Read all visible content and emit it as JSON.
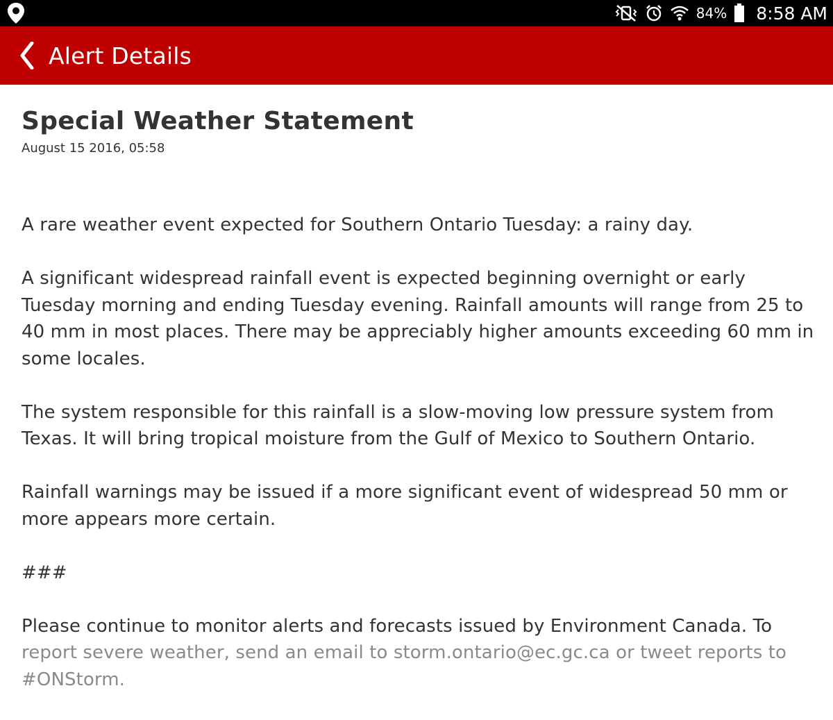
{
  "status_bar": {
    "left_icon": "location-pin-icon",
    "right_icons": [
      "vibrate-mute-icon",
      "alarm-icon",
      "wifi-icon",
      "battery-icon"
    ],
    "battery_percent": "84%",
    "time": "8:58 AM"
  },
  "app_bar": {
    "back_icon": "chevron-left-icon",
    "title": "Alert Details",
    "color": "#be0000"
  },
  "alert": {
    "title": "Special Weather Statement",
    "date": "August 15 2016, 05:58",
    "paragraphs": [
      "A rare weather event expected for Southern Ontario Tuesday: a rainy day.",
      "A significant widespread rainfall event is expected beginning overnight or early Tuesday morning and ending Tuesday evening. Rainfall amounts will range from 25 to 40 mm in most places. There may be appreciably higher amounts exceeding 60 mm in some locales.",
      "The system responsible for this rainfall is a slow-moving low pressure system from Texas. It will bring tropical moisture from the Gulf of Mexico to Southern Ontario.",
      "Rainfall warnings may be issued if a more significant event of widespread 50 mm or more appears more certain.",
      "###"
    ],
    "closing_line": "Please continue to monitor alerts and forecasts issued by Environment Canada. To",
    "closing_rest": "report severe weather, send an email to storm.ontario@ec.gc.ca or tweet reports to #ONStorm."
  }
}
